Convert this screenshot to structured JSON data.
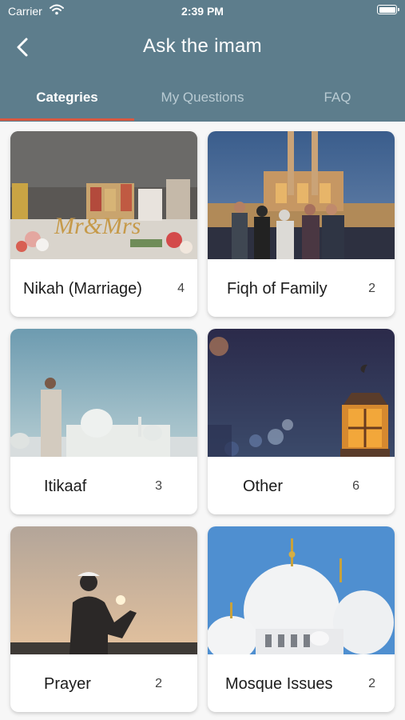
{
  "status_bar": {
    "carrier": "Carrier",
    "time": "2:39 PM"
  },
  "nav": {
    "title": "Ask the imam"
  },
  "tabs": [
    {
      "label": "Categries",
      "active": true
    },
    {
      "label": "My Questions",
      "active": false
    },
    {
      "label": "FAQ",
      "active": false
    }
  ],
  "categories": [
    {
      "title": "Nikah (Marriage)",
      "count": "4",
      "image": "wedding-table-photo"
    },
    {
      "title": "Fiqh of Family",
      "count": "2",
      "image": "family-at-mosque-photo"
    },
    {
      "title": "Itikaaf",
      "count": "3",
      "image": "man-at-mosque-dusk-photo"
    },
    {
      "title": "Other",
      "count": "6",
      "image": "lantern-at-night-photo"
    },
    {
      "title": "Prayer",
      "count": "2",
      "image": "man-praying-at-sunset-photo"
    },
    {
      "title": "Mosque Issues",
      "count": "2",
      "image": "white-mosque-domes-photo"
    }
  ],
  "colors": {
    "header": "#5d7d8c",
    "tab_indicator": "#d9573f",
    "background": "#f7f7f7"
  }
}
